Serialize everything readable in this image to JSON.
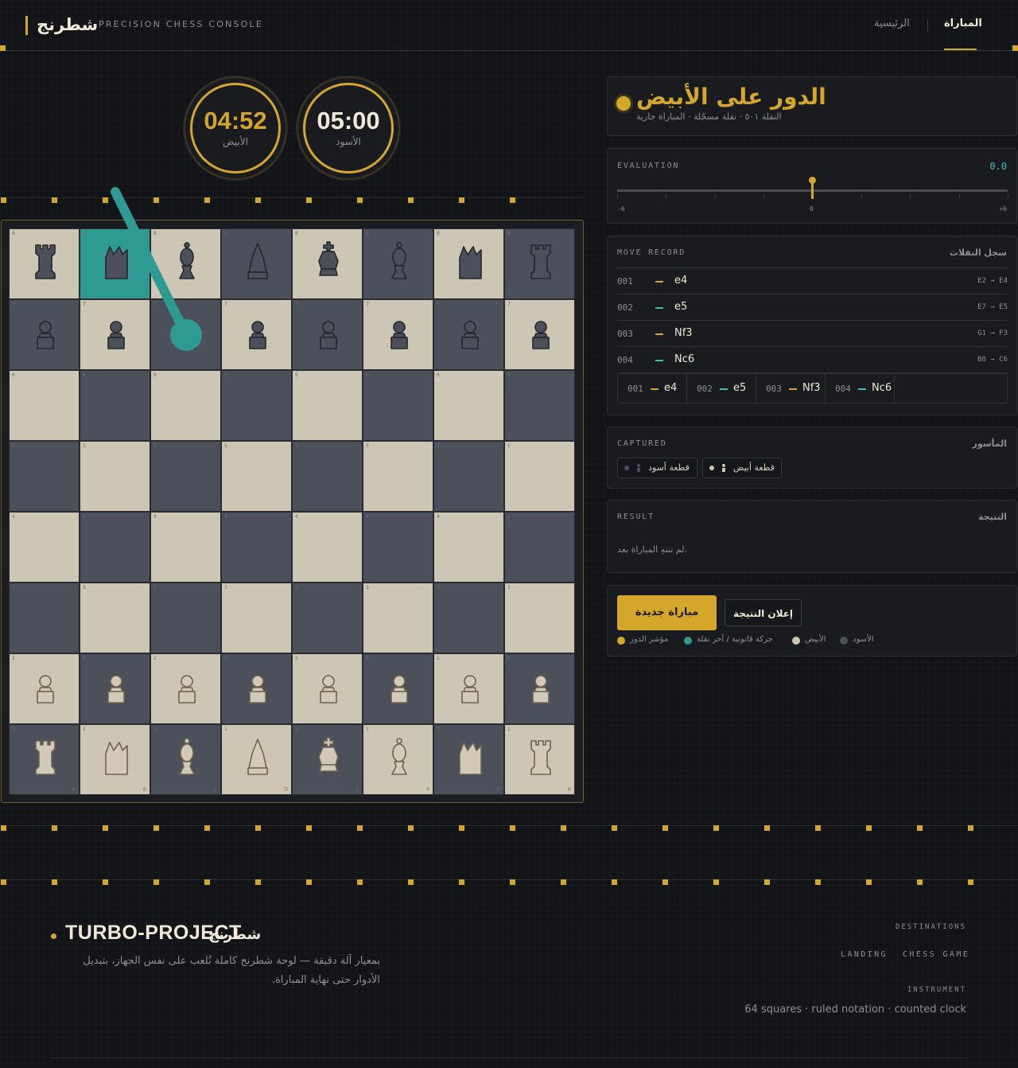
{
  "header": {
    "brand": "شطرنج",
    "subtitle": "PRECISION CHESS CONSOLE",
    "nav": {
      "game": "المباراة",
      "home": "الرئيسية"
    }
  },
  "clocks": {
    "white": {
      "time": "04:52",
      "label": "الأبيض",
      "color": "#d4a62a"
    },
    "black": {
      "time": "05:00",
      "label": "الأسود",
      "color": "#efe9da"
    }
  },
  "board": {
    "files": [
      "A",
      "B",
      "C",
      "D",
      "E",
      "F",
      "G",
      "H"
    ],
    "ranks": [
      "8",
      "7",
      "6",
      "5",
      "4",
      "3",
      "2",
      "1"
    ],
    "highlight": "b8",
    "last_move_arrow": {
      "from": "b8",
      "to": "c7"
    },
    "pieces": {
      "8": [
        "black-rook",
        "black-knight",
        "black-bishop",
        "black-queen",
        "black-king",
        "black-bishop",
        "black-knight",
        "black-rook"
      ],
      "7": [
        "black-pawn",
        "black-pawn",
        "black-pawn",
        "black-pawn",
        "black-pawn",
        "black-pawn",
        "black-pawn",
        "black-pawn"
      ],
      "2": [
        "white-pawn",
        "white-pawn",
        "white-pawn",
        "white-pawn",
        "white-pawn",
        "white-pawn",
        "white-pawn",
        "white-pawn"
      ],
      "1": [
        "white-rook",
        "white-knight",
        "white-bishop",
        "white-queen",
        "white-king",
        "white-bishop",
        "white-knight",
        "white-rook"
      ]
    }
  },
  "turn": {
    "title": "الدور على الأبيض",
    "sub": "النقلة ٥٠١ · نقلة مسجّلة · المباراة جارية"
  },
  "evaluation": {
    "title": "EVALUATION",
    "value": "0.0",
    "fraction": 0.5,
    "min_label": "-6",
    "mid_label": "0",
    "max_label": "+6"
  },
  "moves": {
    "title": "MOVE RECORD",
    "title_ar": "سجل النقلات",
    "rows": [
      {
        "num": "001",
        "san": "e4",
        "coord": "E2 → E4",
        "side": "white"
      },
      {
        "num": "002",
        "san": "e5",
        "coord": "E7 → E5",
        "side": "black"
      },
      {
        "num": "003",
        "san": "Nf3",
        "coord": "G1 → F3",
        "side": "white"
      },
      {
        "num": "004",
        "san": "Nc6",
        "coord": "B8 → C6",
        "side": "black"
      }
    ]
  },
  "captured": {
    "title": "CAPTURED",
    "title_ar": "المأسور",
    "white_chip": "قطعة أبيض",
    "black_chip": "قطعة أسود"
  },
  "result": {
    "title": "RESULT",
    "title_ar": "النتيجة",
    "text": "لم تنتهِ المباراة بعد."
  },
  "actions": {
    "new_game": "مباراة جديدة",
    "claim": "إعلان النتيجة",
    "legend": [
      {
        "label": "مؤشر الدور",
        "color": "#d4a62a"
      },
      {
        "label": "حركة قانونية / آخر نقلة",
        "color": "#2e9a91"
      },
      {
        "label": "الأبيض",
        "color": "#cdc6b5"
      },
      {
        "label": "الأسود",
        "color": "#4b505a"
      }
    ]
  },
  "footer": {
    "title": "TURBO-PROJECT",
    "title_ar": "شطرنج",
    "description": "بمعيار آلة دقيقة — لوحة شطرنج كاملة تُلعب على نفس الجهاز، بتبديل الأدوار حتى نهاية المباراة.",
    "destinations_label": "DESTINATIONS",
    "links": [
      "LANDING",
      "CHESS GAME"
    ],
    "instrument_label": "INSTRUMENT",
    "instrument_text": "64 squares · ruled notation · counted clock"
  },
  "colors": {
    "accent": "#d4a62a",
    "teal": "#2e9a91",
    "light_square": "#cdc6b5",
    "dark_square": "#4b505a"
  }
}
